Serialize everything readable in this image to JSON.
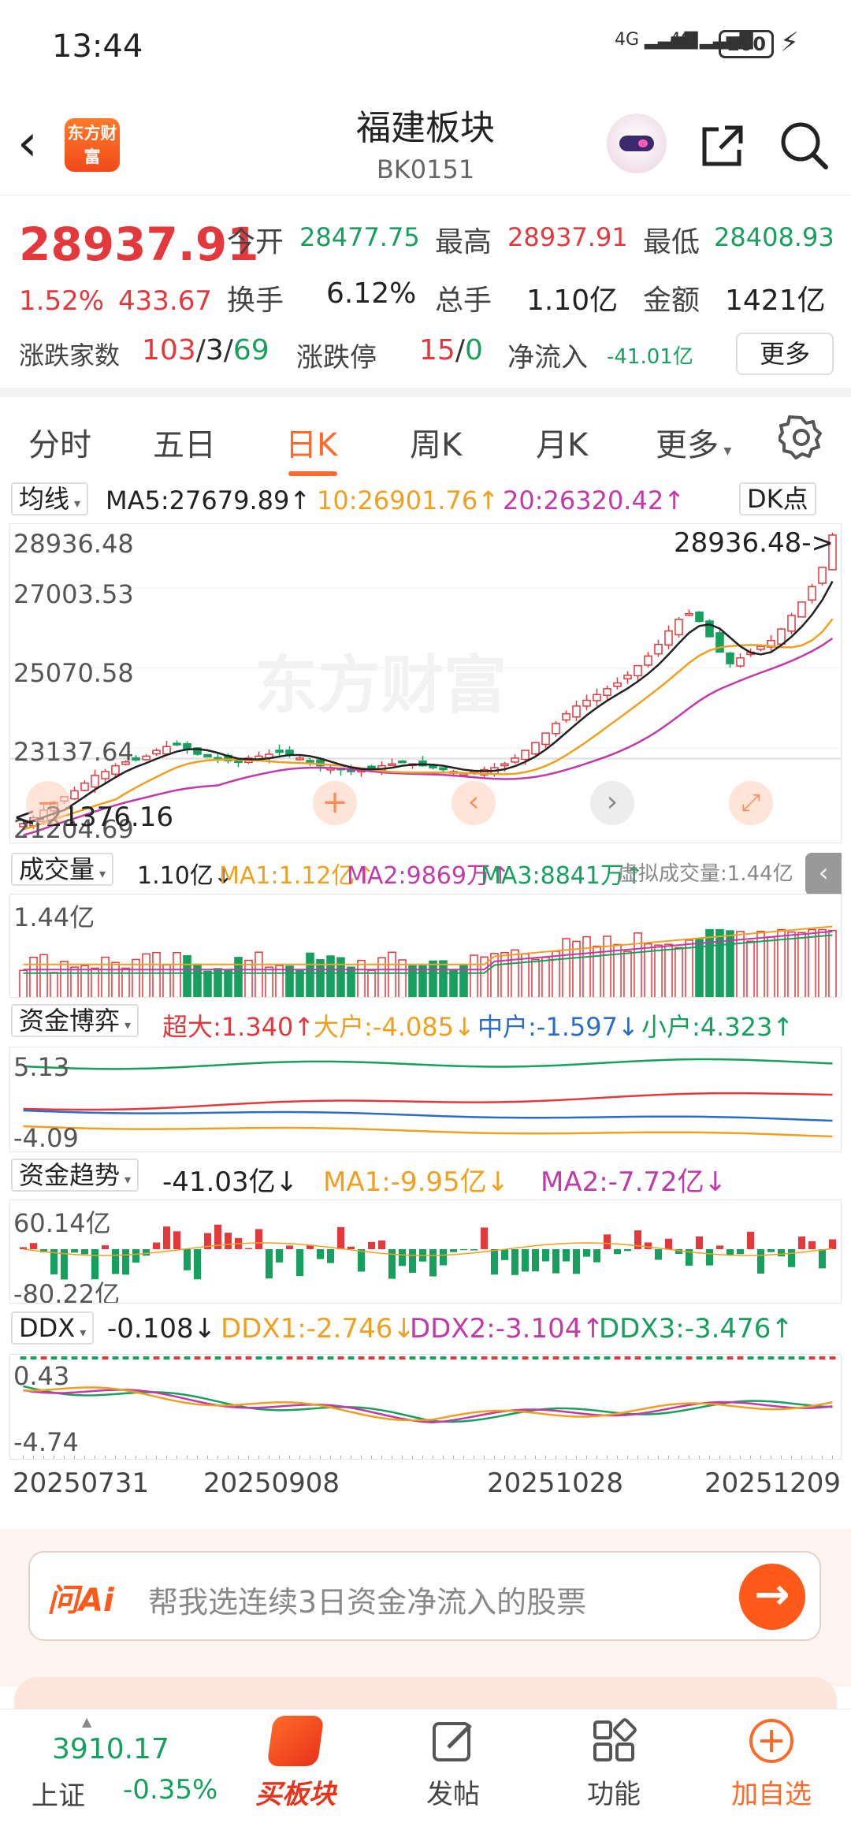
{
  "status": {
    "time": "13:44",
    "net1": "4G",
    "net2": "4G",
    "battery": "100"
  },
  "header": {
    "title": "福建板块",
    "code": "BK0151",
    "logo_text": "东方财富"
  },
  "quote": {
    "price": "28937.91",
    "pct": "1.52%",
    "change": "433.67",
    "open_label": "今开",
    "open": "28477.75",
    "high_label": "最高",
    "high": "28937.91",
    "low_label": "最低",
    "low": "28408.93",
    "turnover_label": "换手",
    "turnover": "6.12%",
    "volume_label": "总手",
    "volume": "1.10亿",
    "amount_label": "金额",
    "amount": "1421亿",
    "breadth_label": "涨跌家数",
    "breadth_up": "103",
    "breadth_flat": "3",
    "breadth_down": "69",
    "limit_label": "涨跌停",
    "limit_up": "15",
    "limit_down": "0",
    "inflow_label": "净流入",
    "inflow": "-41.01亿",
    "more": "更多"
  },
  "tabs": [
    "分时",
    "五日",
    "日K",
    "周K",
    "月K",
    "更多"
  ],
  "active_tab": "日K",
  "kline": {
    "selector": "均线",
    "ma5": "MA5:27679.89↑",
    "ma10": "10:26901.76↑",
    "ma20": "20:26320.42↑",
    "dk": "DK点",
    "y_top": "28936.48",
    "y2": "27003.53",
    "y3": "25070.58",
    "y4": "23137.64",
    "y_bottom": "21204.69",
    "max_mark": "28936.48->",
    "min_mark": "<-21376.16",
    "watermark": "东方财富"
  },
  "volume": {
    "selector": "成交量",
    "vol": "1.10亿↓",
    "ma1": "MA1:1.12亿↑",
    "ma2": "MA2:9869万↑",
    "ma3": "MA3:8841万↑",
    "virtual": "虚拟成交量:1.44亿",
    "y_top": "1.44亿"
  },
  "fund": {
    "selector": "资金博弈",
    "super": "超大:1.340↑",
    "big": "大户:-4.085↓",
    "mid": "中户:-1.597↓",
    "small": "小户:4.323↑",
    "y_top": "5.13",
    "y_bottom": "-4.09"
  },
  "trend": {
    "selector": "资金趋势",
    "value": "-41.03亿↓",
    "ma1": "MA1:-9.95亿↓",
    "ma2": "MA2:-7.72亿↓",
    "y_top": "60.14亿",
    "y_bottom": "-80.22亿"
  },
  "ddx": {
    "selector": "DDX",
    "value": "-0.108↓",
    "ddx1": "DDX1:-2.746↓",
    "ddx2": "DDX2:-3.104↑",
    "ddx3": "DDX3:-3.476↑",
    "y_top": "0.43",
    "y_bottom": "-4.74"
  },
  "dates": [
    "20250731",
    "20250908",
    "20251028",
    "20251209"
  ],
  "ai": {
    "logo": "问Ai",
    "placeholder": "帮我选连续3日资金净流入的股票"
  },
  "bottom": {
    "index_value": "3910.17",
    "index_name": "上证",
    "index_change": "-0.35%",
    "buy": "买板块",
    "post": "发帖",
    "func": "功能",
    "add": "加自选"
  },
  "colors": {
    "up": "#e4393c",
    "down": "#17a05d",
    "accent": "#ff6a2a"
  },
  "chart_data": {
    "type": "candlestick",
    "ylim": [
      21204.69,
      28936.48
    ],
    "high_value": 28936.48,
    "low_value": 21376.16,
    "close_series": [
      21450,
      21600,
      21800,
      22000,
      22150,
      22300,
      22500,
      22700,
      22800,
      22950,
      23050,
      23100,
      23200,
      23350,
      23450,
      23500,
      23380,
      23250,
      23180,
      23120,
      23080,
      23050,
      23150,
      23200,
      23250,
      23300,
      23250,
      23150,
      23050,
      22950,
      22900,
      22850,
      22800,
      22850,
      22900,
      22950,
      23000,
      23050,
      23000,
      22950,
      22900,
      22850,
      22800,
      22750,
      22800,
      22850,
      22900,
      23000,
      23150,
      23350,
      23550,
      23800,
      24050,
      24300,
      24500,
      24650,
      24800,
      24950,
      25100,
      25300,
      25550,
      25800,
      26100,
      26450,
      26750,
      26900,
      26700,
      26300,
      25900,
      25600,
      25750,
      25900,
      26050,
      26200,
      26500,
      26850,
      27200,
      27600,
      28100,
      28937.91
    ]
  }
}
